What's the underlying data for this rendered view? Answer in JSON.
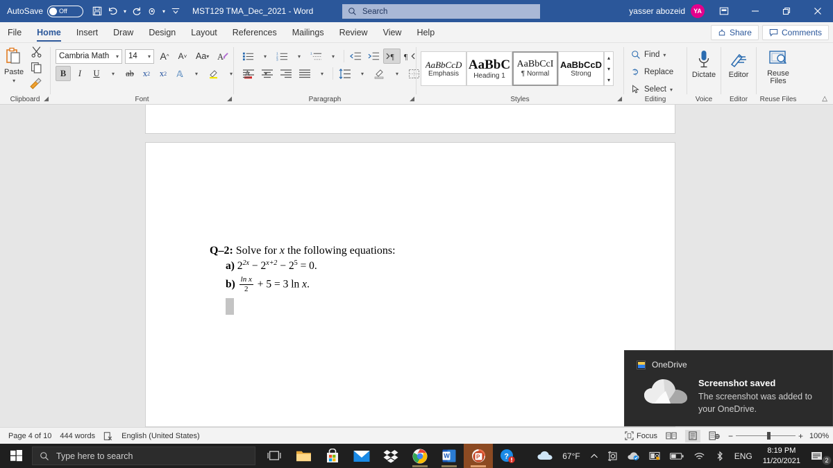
{
  "titlebar": {
    "autosave_label": "AutoSave",
    "autosave_state": "Off",
    "quick_access": [
      {
        "name": "save-icon",
        "glyph": "💾"
      },
      {
        "name": "undo-icon",
        "glyph": "↶"
      },
      {
        "name": "undo-dropdown-icon",
        "glyph": "⌄"
      },
      {
        "name": "redo-icon",
        "glyph": "↻"
      },
      {
        "name": "touch-mode-icon",
        "glyph": "☚"
      },
      {
        "name": "touch-dropdown-icon",
        "glyph": "⌄"
      },
      {
        "name": "customize-quick-access-icon",
        "glyph": "⩟"
      }
    ],
    "document_title": "MST129 TMA_Dec_2021  -  Word",
    "search_placeholder": "Search",
    "user_name": "yasser abozeid",
    "user_initials": "YA",
    "avatar_color": "#e3008c",
    "window_buttons": [
      {
        "name": "ribbon-display-options-button",
        "glyph": "⬒"
      },
      {
        "name": "minimize-button",
        "glyph": "—"
      },
      {
        "name": "restore-button",
        "glyph": "❐"
      },
      {
        "name": "close-button",
        "glyph": "✕"
      }
    ],
    "accent_color": "#2b579a"
  },
  "tabs": [
    {
      "label": "File",
      "active": false
    },
    {
      "label": "Home",
      "active": true
    },
    {
      "label": "Insert",
      "active": false
    },
    {
      "label": "Draw",
      "active": false
    },
    {
      "label": "Design",
      "active": false
    },
    {
      "label": "Layout",
      "active": false
    },
    {
      "label": "References",
      "active": false
    },
    {
      "label": "Mailings",
      "active": false
    },
    {
      "label": "Review",
      "active": false
    },
    {
      "label": "View",
      "active": false
    },
    {
      "label": "Help",
      "active": false
    }
  ],
  "tab_actions": {
    "share_label": "Share",
    "comments_label": "Comments"
  },
  "ribbon": {
    "clipboard": {
      "group_label": "Clipboard",
      "paste_label": "Paste",
      "buttons": [
        "cut-icon",
        "copy-icon",
        "format-painter-icon"
      ]
    },
    "font": {
      "group_label": "Font",
      "font_name": "Cambria Math",
      "font_size": "14",
      "grow_font": "A",
      "shrink_font": "A",
      "change_case": "Aa",
      "clear_formatting": "A",
      "bold": "B",
      "italic": "I",
      "underline": "U",
      "strikethrough": "ab",
      "subscript": "x",
      "superscript": "x",
      "text_effects": "A",
      "highlight": "✐",
      "font_color": "A"
    },
    "paragraph": {
      "group_label": "Paragraph",
      "row1": [
        "bullets-icon",
        "numbering-icon",
        "multilevel-list-icon",
        "decrease-indent-icon",
        "increase-indent-icon",
        "ltr-text-direction-icon",
        "rtl-text-direction-icon",
        "sort-icon",
        "show-marks-icon"
      ],
      "row2": [
        "align-left-icon",
        "align-center-icon",
        "align-right-icon",
        "justify-icon",
        "line-spacing-icon",
        "shading-icon",
        "borders-icon"
      ]
    },
    "styles": {
      "group_label": "Styles",
      "items": [
        {
          "preview": "AaBbCcD",
          "name": "Emphasis",
          "selected": false
        },
        {
          "preview": "AaBbC",
          "name": "Heading 1",
          "selected": false
        },
        {
          "preview": "AaBbCcI",
          "name": "¶ Normal",
          "selected": true
        },
        {
          "preview": "AaBbCcD",
          "name": "Strong",
          "selected": false
        }
      ]
    },
    "editing": {
      "group_label": "Editing",
      "find_label": "Find",
      "replace_label": "Replace",
      "select_label": "Select"
    },
    "voice": {
      "group_label": "Voice",
      "dictate_label": "Dictate"
    },
    "editor": {
      "group_label": "Editor",
      "editor_label": "Editor"
    },
    "reuse": {
      "group_label": "Reuse Files",
      "reuse_label_line1": "Reuse",
      "reuse_label_line2": "Files"
    }
  },
  "document": {
    "question_label": "Q–2:",
    "question_text": "Solve for",
    "question_var": "x",
    "question_tail": "the following equations:",
    "item_a_label": "a)",
    "item_a_eq": {
      "t1_base": "2",
      "t1_exp": "2x",
      "minus1": "−",
      "t2_base": "2",
      "t2_exp": "x+2",
      "minus2": "−",
      "t3_base": "2",
      "t3_exp": "5",
      "equals": "= 0."
    },
    "item_b_label": "b)",
    "item_b_eq": {
      "frac_num": "ln x",
      "frac_den": "2",
      "rest": "+ 5 = 3 ln",
      "var": "x",
      "period": "."
    }
  },
  "statusbar": {
    "page_info": "Page 4 of 10",
    "word_count": "444 words",
    "proofing_icon": "proofing-errors-icon",
    "language": "English (United States)",
    "focus_label": "Focus",
    "views": [
      {
        "name": "read-mode-view-button",
        "glyph": "📖",
        "selected": false
      },
      {
        "name": "print-layout-view-button",
        "glyph": "▤",
        "selected": true
      },
      {
        "name": "web-layout-view-button",
        "glyph": "▧",
        "selected": false
      }
    ],
    "zoom_out": "−",
    "zoom_in": "+",
    "zoom_level": "100%"
  },
  "toast": {
    "app_name": "OneDrive",
    "title": "Screenshot saved",
    "message": "The screenshot was added to your OneDrive."
  },
  "taskbar": {
    "start_icon": "windows-start-icon",
    "search_placeholder": "Type here to search",
    "task_view_icon": "task-view-icon",
    "apps": [
      {
        "name": "file-explorer-icon",
        "active": false
      },
      {
        "name": "microsoft-store-icon",
        "active": false
      },
      {
        "name": "mail-icon",
        "active": false
      },
      {
        "name": "dropbox-icon",
        "active": false
      },
      {
        "name": "google-chrome-icon",
        "running": true,
        "active": false
      },
      {
        "name": "microsoft-word-icon",
        "running": true,
        "active": false
      },
      {
        "name": "microsoft-powerpoint-icon",
        "running": true,
        "active": true
      },
      {
        "name": "help-support-icon",
        "active": false
      }
    ],
    "weather_temp": "67°F",
    "tray": [
      {
        "name": "show-hidden-icons-button",
        "glyph": "∧"
      },
      {
        "name": "camera-app-icon",
        "glyph": "◎"
      },
      {
        "name": "onedrive-tray-icon",
        "glyph": "☁"
      },
      {
        "name": "realtek-audio-icon",
        "glyph": "▣"
      },
      {
        "name": "battery-icon",
        "glyph": "▭"
      },
      {
        "name": "network-wifi-icon",
        "glyph": "◠"
      },
      {
        "name": "bluetooth-icon",
        "glyph": "ᛦ"
      }
    ],
    "language_indicator": "ENG",
    "time": "8:19 PM",
    "date": "11/20/2021",
    "notification_count": "2"
  }
}
